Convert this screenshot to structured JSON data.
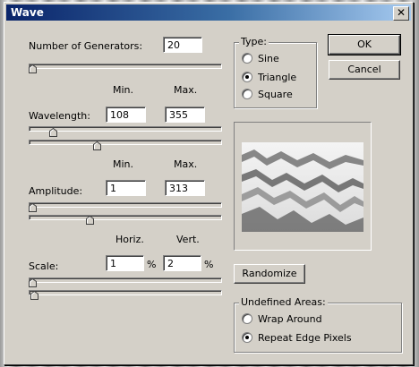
{
  "window": {
    "title": "Wave",
    "close_glyph": "✕"
  },
  "generators": {
    "label": "Number of Generators:",
    "value": "20",
    "level": 0.0
  },
  "headers": {
    "min": "Min.",
    "max": "Max.",
    "horiz": "Horiz.",
    "vert": "Vert."
  },
  "wavelength": {
    "label": "Wavelength:",
    "min": "108",
    "max": "355",
    "min_level": 0.11,
    "max_level": 0.35
  },
  "amplitude": {
    "label": "Amplitude:",
    "min": "1",
    "max": "313",
    "min_level": 0.0,
    "max_level": 0.31
  },
  "scale": {
    "label": "Scale:",
    "horiz": "1",
    "vert": "2",
    "unit": "%",
    "horiz_level": 0.0,
    "vert_level": 0.01
  },
  "type_group": {
    "legend": "Type:",
    "options": [
      "Sine",
      "Triangle",
      "Square"
    ],
    "selected": "Triangle"
  },
  "buttons": {
    "ok": "OK",
    "cancel": "Cancel",
    "randomize": "Randomize"
  },
  "undefined_areas": {
    "legend": "Undefined Areas:",
    "options": [
      "Wrap Around",
      "Repeat Edge Pixels"
    ],
    "selected": "Repeat Edge Pixels"
  },
  "preview": {
    "description_icon": "wave-preview"
  }
}
